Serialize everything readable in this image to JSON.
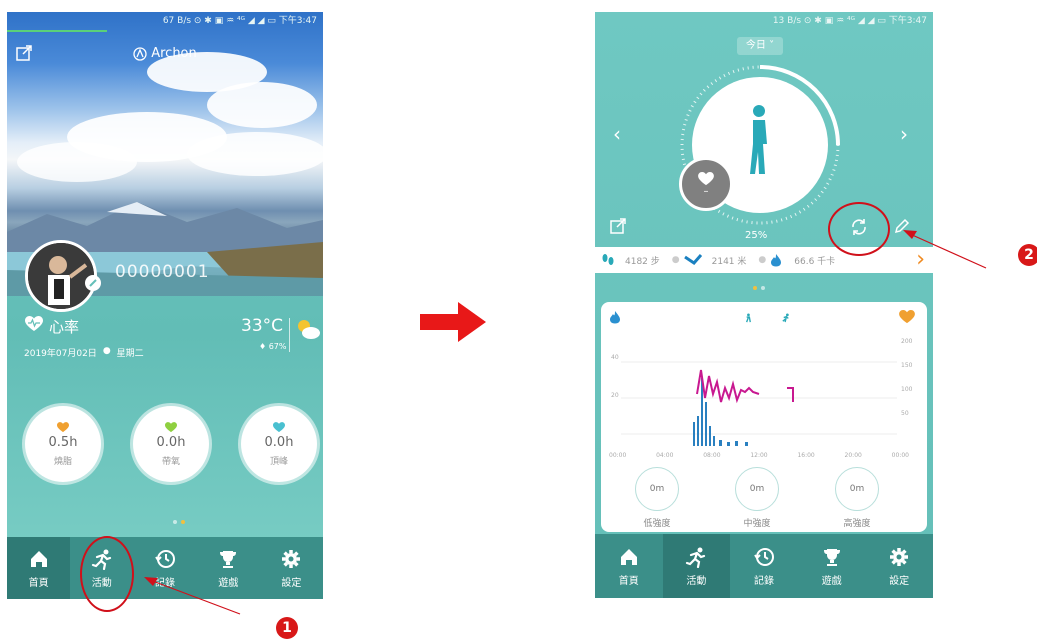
{
  "left_screen": {
    "status_bar": {
      "left": "",
      "right": "67 B/s ⊙ ✱ ▣ ♒ ⁴ᴳ ◢ ◢ ▭ 下午3:47"
    },
    "app_title": "Archon",
    "user_id": "00000001",
    "heart_rate": {
      "label": "心率",
      "date": "2019年07月02日",
      "weekday": "星期二"
    },
    "weather": {
      "temp": "33°C",
      "humidity": "67%"
    },
    "stats": [
      {
        "value": "0.5h",
        "label": "燒脂",
        "heart_color": "#f0a030"
      },
      {
        "value": "0.0h",
        "label": "帶氧",
        "heart_color": "#8fd040"
      },
      {
        "value": "0.0h",
        "label": "頂峰",
        "heart_color": "#4ac0d0"
      }
    ],
    "nav": [
      "首頁",
      "活動",
      "記錄",
      "遊戲",
      "設定"
    ]
  },
  "right_screen": {
    "status_bar": {
      "left": "",
      "right": "13 B/s ⊙ ✱ ▣ ♒ ⁴ᴳ ◢ ◢ ▭ 下午3:47"
    },
    "date_selector": "今日",
    "heart_value": "–",
    "progress_percent": "25%",
    "progress_fraction": 0.25,
    "metrics": {
      "steps": "4182 步",
      "distance": "2141 米",
      "calories": "66.6 千卡"
    },
    "chart": {
      "y_left": [
        "40",
        "20"
      ],
      "y_right": [
        "200",
        "150",
        "100",
        "50"
      ],
      "x": [
        "00:00",
        "04:00",
        "08:00",
        "12:00",
        "16:00",
        "20:00",
        "00:00"
      ]
    },
    "intensity": [
      {
        "value": "0m",
        "label": "低強度"
      },
      {
        "value": "0m",
        "label": "中強度"
      },
      {
        "value": "0m",
        "label": "高強度"
      }
    ],
    "nav": [
      "首頁",
      "活動",
      "記錄",
      "遊戲",
      "設定"
    ]
  },
  "annotations": {
    "step1": "1",
    "step2": "2"
  },
  "colors": {
    "teal": "#64bfb8",
    "nav": "#3b8f89",
    "red": "#d81818"
  }
}
